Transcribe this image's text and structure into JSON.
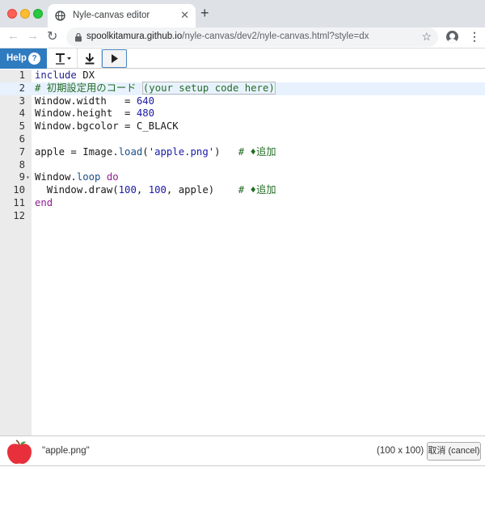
{
  "browser": {
    "tab_title": "Nyle-canvas editor",
    "url_host": "spoolkitamura.github.io",
    "url_path": "/nyle-canvas/dev2/nyle-canvas.html?style=dx"
  },
  "app_toolbar": {
    "help_label": "Help",
    "help_icon": "?",
    "text_icon": "text-format-icon",
    "download_icon": "download-icon",
    "run_icon": "play-icon"
  },
  "editor": {
    "line_numbers": [
      "1",
      "2",
      "3",
      "4",
      "5",
      "6",
      "7",
      "8",
      "9",
      "10",
      "11",
      "12"
    ],
    "active_line": 2,
    "lines": [
      [
        {
          "t": "include",
          "c": "kw"
        },
        {
          "t": " DX",
          "c": ""
        }
      ],
      [
        {
          "t": "# 初期設定用のコード ",
          "c": "cm"
        },
        {
          "t": "(your setup code here)",
          "c": "cm box"
        }
      ],
      [
        {
          "t": "Window.width   = ",
          "c": ""
        },
        {
          "t": "640",
          "c": "num"
        }
      ],
      [
        {
          "t": "Window.height  = ",
          "c": ""
        },
        {
          "t": "480",
          "c": "num"
        }
      ],
      [
        {
          "t": "Window.bgcolor = C_BLACK",
          "c": ""
        }
      ],
      [],
      [
        {
          "t": "apple = Image.",
          "c": ""
        },
        {
          "t": "load",
          "c": "fn"
        },
        {
          "t": "(",
          "c": ""
        },
        {
          "t": "'apple.png'",
          "c": "str"
        },
        {
          "t": ")   ",
          "c": ""
        },
        {
          "t": "# ♦追加",
          "c": "cm"
        }
      ],
      [],
      [
        {
          "t": "Window.",
          "c": ""
        },
        {
          "t": "loop",
          "c": "fn"
        },
        {
          "t": " ",
          "c": ""
        },
        {
          "t": "do",
          "c": "kw2"
        }
      ],
      [
        {
          "t": "  Window.draw(",
          "c": ""
        },
        {
          "t": "100",
          "c": "num"
        },
        {
          "t": ", ",
          "c": ""
        },
        {
          "t": "100",
          "c": "num"
        },
        {
          "t": ", apple)    ",
          "c": ""
        },
        {
          "t": "# ♦追加",
          "c": "cm"
        }
      ],
      [
        {
          "t": "end",
          "c": "kw2"
        }
      ],
      []
    ],
    "fold_marker_line": 9
  },
  "asset": {
    "name": "\"apple.png\"",
    "size": "(100 x 100)",
    "cancel_label": "取消 (cancel)",
    "thumbnail_icon": "apple-icon"
  }
}
